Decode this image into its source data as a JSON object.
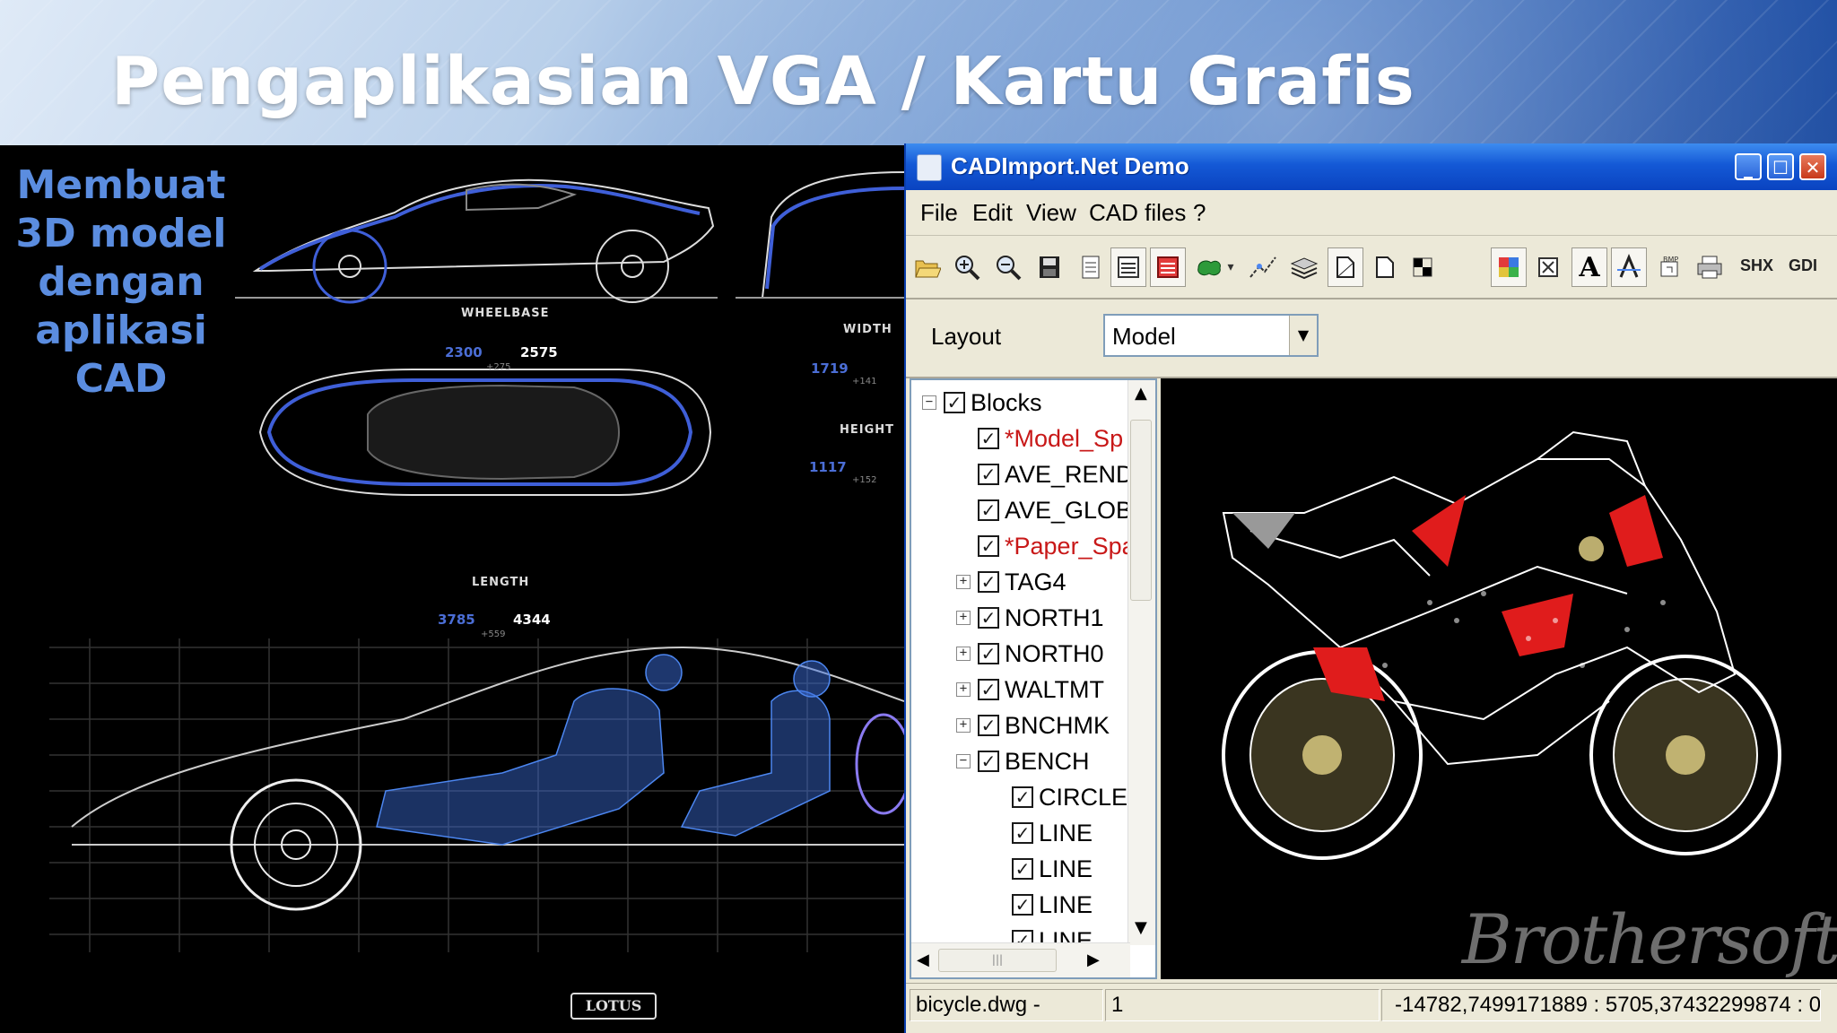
{
  "slide": {
    "title": "Pengaplikasian VGA / Kartu Grafis",
    "caption_lines": [
      "Membuat",
      "3D model",
      "dengan",
      "aplikasi",
      "CAD"
    ]
  },
  "car_drawing": {
    "wheelbase_label": "WHEELBASE",
    "wheelbase_alise": "2300",
    "wheelbase_eagle": "2575",
    "wheelbase_diff": "+275",
    "length_label": "LENGTH",
    "length_alise": "3785",
    "length_eagle": "4344",
    "length_diff": "+559",
    "width_label": "WIDTH",
    "width_alise": "1719",
    "width_diff": "+141",
    "height_label": "HEIGHT",
    "height_alise": "1117",
    "height_diff": "+152",
    "brand_mark": "LOTUS"
  },
  "cad_window": {
    "title": "CADImport.Net Demo",
    "window_controls": [
      "_",
      "☐",
      "✕"
    ],
    "menu": [
      "File",
      "Edit",
      "View",
      "CAD files",
      "?"
    ],
    "toolbar_text_buttons": [
      "SHX",
      "GDI"
    ],
    "layout_label": "Layout",
    "layout_value": "Model",
    "tree_items": [
      {
        "label": "Blocks",
        "level": 0,
        "expander": "−",
        "red": false
      },
      {
        "label": "*Model_Sp",
        "level": 1,
        "expander": "",
        "red": true
      },
      {
        "label": "AVE_REND",
        "level": 1,
        "expander": "",
        "red": false
      },
      {
        "label": "AVE_GLOB",
        "level": 1,
        "expander": "",
        "red": false
      },
      {
        "label": "*Paper_Spa",
        "level": 1,
        "expander": "",
        "red": true
      },
      {
        "label": "TAG4",
        "level": 1,
        "expander": "+",
        "red": false
      },
      {
        "label": "NORTH1",
        "level": 1,
        "expander": "+",
        "red": false
      },
      {
        "label": "NORTH0",
        "level": 1,
        "expander": "+",
        "red": false
      },
      {
        "label": "WALTMT",
        "level": 1,
        "expander": "+",
        "red": false
      },
      {
        "label": "BNCHMK",
        "level": 1,
        "expander": "+",
        "red": false
      },
      {
        "label": "BENCH",
        "level": 1,
        "expander": "−",
        "red": false
      },
      {
        "label": "CIRCLE",
        "level": 2,
        "expander": "",
        "red": false
      },
      {
        "label": "LINE",
        "level": 2,
        "expander": "",
        "red": false
      },
      {
        "label": "LINE",
        "level": 2,
        "expander": "",
        "red": false
      },
      {
        "label": "LINE",
        "level": 2,
        "expander": "",
        "red": false
      },
      {
        "label": "LINE",
        "level": 2,
        "expander": "",
        "red": false
      }
    ],
    "watermark": "Brothersoft",
    "status": {
      "file": "bicycle.dwg -",
      "page": "1",
      "coords": "-14782,7499171889 : 5705,37432299874 : 0"
    }
  },
  "colors": {
    "caption": "#5b8de0",
    "titlebar": "#1459d6",
    "car_outline": "#3f5fd8"
  }
}
